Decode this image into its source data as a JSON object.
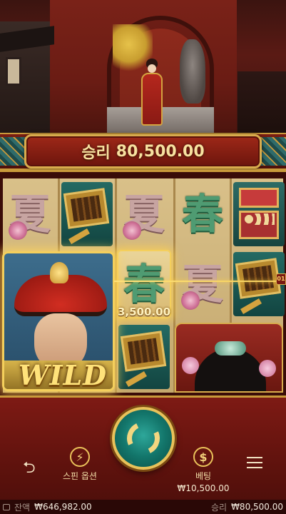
{
  "win_banner": {
    "label": "승리",
    "amount": "80,500.00"
  },
  "reels": {
    "characters": {
      "jade": "春",
      "pink": "夏"
    },
    "wild_label": "WILD",
    "win_amount": "3,500.00",
    "payline_number": "01"
  },
  "controls": {
    "spin_options_label": "스핀 옵션",
    "bet_label": "베팅",
    "bet_value": "₩10,500.00"
  },
  "footer": {
    "balance_label": "잔액",
    "balance_value": "₩646,982.00",
    "win_label": "승리",
    "win_value": "₩80,500.00"
  },
  "colors": {
    "gold": "#d8ac4d",
    "jade": "#4f9b72",
    "red": "#9e2818",
    "teal": "#13766b"
  }
}
